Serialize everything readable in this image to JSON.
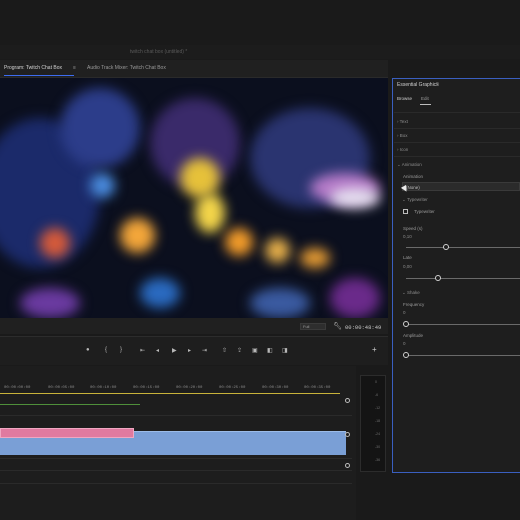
{
  "window": {
    "title": "twitch chat box (untitled) *"
  },
  "monitor": {
    "tabs": [
      {
        "label": "Program: Twitch Chat Box",
        "active": true
      },
      {
        "label": "Audio Track Mixer: Twitch Chat Box",
        "active": false
      }
    ],
    "timecode": "00:00:48:49",
    "fit": "Full",
    "ruler_labels": [
      "00:00:00:00",
      "00:00:05:00",
      "00:00:10:00",
      "00:00:15:00",
      "00:00:20:00",
      "00:00:25:00",
      "00:00:30:00",
      "00:00:35:00"
    ]
  },
  "meter": {
    "labels": [
      "0",
      "-6",
      "-12",
      "-18",
      "-24",
      "-30",
      "-36",
      "-42",
      "-48",
      "-54"
    ]
  },
  "essential_graphics": {
    "title": "Essential Graphics",
    "tabs": {
      "browse": "Browse",
      "edit": "Edit"
    },
    "sections": {
      "text": "Text",
      "box": "Box",
      "icon": "Icon",
      "animation": "Animation"
    },
    "animation": {
      "label": "Animation",
      "value": "(None)",
      "typewriter_section": "Typewriter",
      "typewriter_checkbox": "Typewriter",
      "speed_label": "Speed (s)",
      "speed_value": "0,10",
      "speed_fraction": 0.35,
      "late_label": "Late",
      "late_value": "0,00",
      "late_fraction": 0.28,
      "shake_section": "Shake",
      "frequency_label": "Frequency",
      "frequency_value": "0",
      "frequency_fraction": 0.0,
      "amplitude_label": "Amplitude",
      "amplitude_value": "0",
      "amplitude_fraction": 0.0
    }
  }
}
